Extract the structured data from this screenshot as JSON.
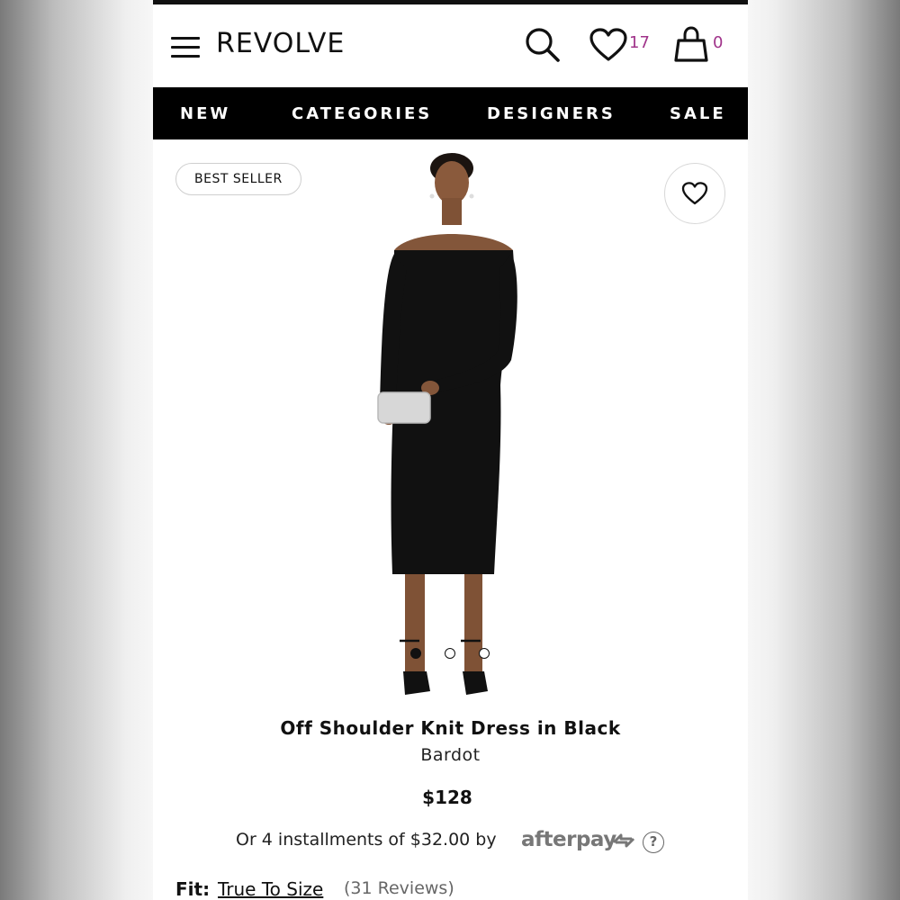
{
  "header": {
    "logo": "REVOLVE",
    "wishlist_count": "17",
    "bag_count": "0"
  },
  "nav": {
    "items": [
      "NEW",
      "CATEGORIES",
      "DESIGNERS",
      "SALE"
    ]
  },
  "product": {
    "tag": "BEST SELLER",
    "title": "Off Shoulder Knit Dress in Black",
    "brand": "Bardot",
    "price": "$128",
    "installments_text": "Or 4 installments of $32.00 by",
    "afterpay_label": "afterpay",
    "help_label": "?",
    "image_count": 3,
    "active_image": 1,
    "fit_label": "Fit:",
    "fit_value": "True To Size",
    "reviews": "(31 Reviews)"
  },
  "colors": {
    "accent_badge": "#a0338a",
    "nav_bg": "#000000",
    "dress": "#111111"
  },
  "icons": [
    "menu-icon",
    "search-icon",
    "heart-icon",
    "bag-icon",
    "help-icon"
  ]
}
